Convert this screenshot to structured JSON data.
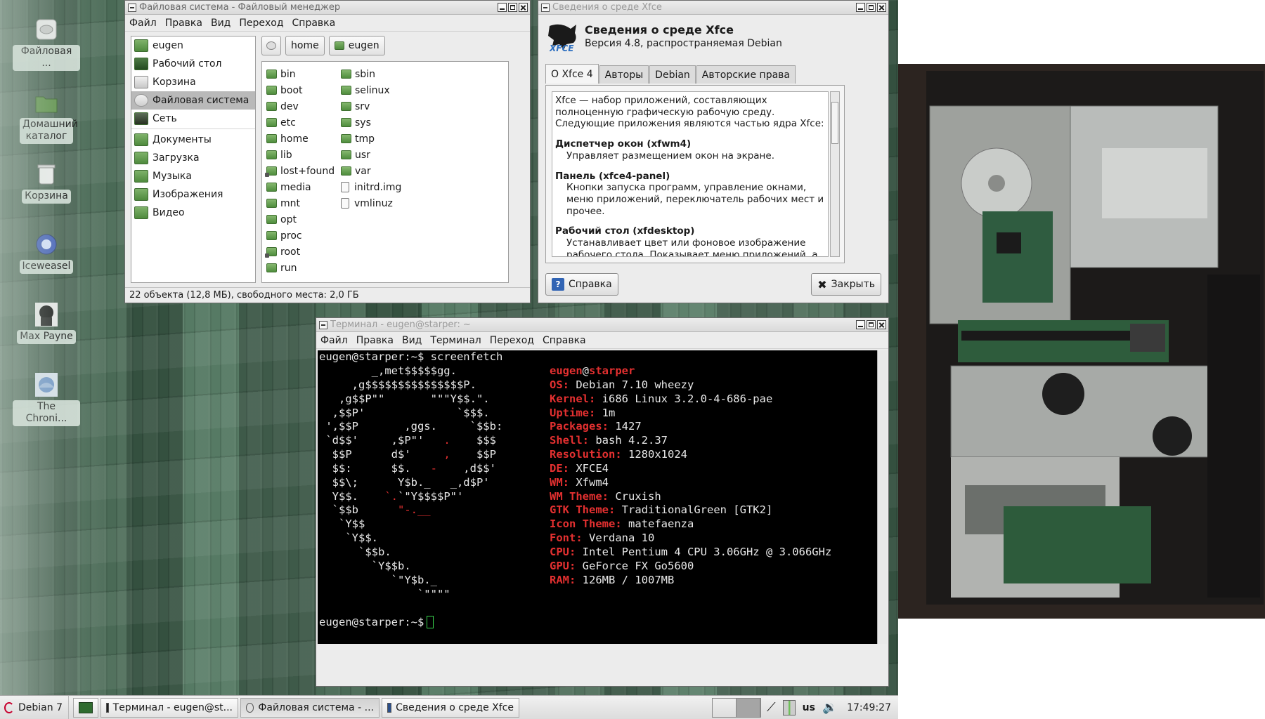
{
  "desktop": {
    "icons": [
      {
        "label": "Файловая ...",
        "icon": "filesystem-icon"
      },
      {
        "label": "Домашний каталог",
        "icon": "home-folder-icon"
      },
      {
        "label": "Корзина",
        "icon": "trash-icon"
      },
      {
        "label": "Iceweasel",
        "icon": "iceweasel-icon"
      },
      {
        "label": "Max Payne",
        "icon": "max-payne-icon"
      },
      {
        "label": "The Chroni...",
        "icon": "chronicles-icon"
      }
    ]
  },
  "file_manager": {
    "title": "Файловая система - Файловый менеджер",
    "menu": [
      "Файл",
      "Правка",
      "Вид",
      "Переход",
      "Справка"
    ],
    "sidebar": [
      {
        "label": "eugen",
        "icon": "home-icon"
      },
      {
        "label": "Рабочий стол",
        "icon": "desktop-icon"
      },
      {
        "label": "Корзина",
        "icon": "trash-icon"
      },
      {
        "label": "Файловая система",
        "icon": "filesystem-icon",
        "selected": true
      },
      {
        "label": "Сеть",
        "icon": "network-icon"
      },
      {
        "label": "Документы",
        "icon": "documents-icon"
      },
      {
        "label": "Загрузка",
        "icon": "downloads-icon"
      },
      {
        "label": "Музыка",
        "icon": "music-icon"
      },
      {
        "label": "Изображения",
        "icon": "pictures-icon"
      },
      {
        "label": "Видео",
        "icon": "video-icon"
      }
    ],
    "path": [
      "home",
      "eugen"
    ],
    "files_col1": [
      "bin",
      "boot",
      "dev",
      "etc",
      "home",
      "lib",
      "lost+found",
      "media",
      "mnt",
      "opt",
      "proc",
      "root",
      "run"
    ],
    "files_col2": [
      "sbin",
      "selinux",
      "srv",
      "sys",
      "tmp",
      "usr",
      "var",
      "initrd.img",
      "vmlinuz"
    ],
    "status": "22 объекта (12,8 МБ), свободного места: 2,0 ГБ"
  },
  "about": {
    "title": "Сведения о среде Xfce",
    "heading": "Сведения о среде Xfce",
    "version": "Версия 4.8, распространяемая Debian",
    "tabs": [
      "О Xfce 4",
      "Авторы",
      "Debian",
      "Авторские права"
    ],
    "intro": "Xfce — набор приложений, составляющих полноценную графическую рабочую среду. Следующие приложения являются частью ядра Xfce:",
    "sections": [
      {
        "h": "Диспетчер окон (xfwm4)",
        "d": "Управляет размещением окон на экране."
      },
      {
        "h": "Панель (xfce4-panel)",
        "d": "Кнопки запуска программ, управление окнами, меню приложений, переключатель рабочих мест и прочее."
      },
      {
        "h": "Рабочий стол (xfdesktop)",
        "d": "Устанавливает цвет или фоновое изображение рабочего стола. Показывает меню приложений, а также значки"
      }
    ],
    "help_label": "Справка",
    "close_label": "Закрыть"
  },
  "terminal": {
    "title": "Терминал - eugen@starper: ~",
    "menu": [
      "Файл",
      "Правка",
      "Вид",
      "Терминал",
      "Переход",
      "Справка"
    ],
    "prompt1": "eugen@starper:~$ screenfetch",
    "ascii": [
      "        _,met$$$$$gg.",
      "     ,g$$$$$$$$$$$$$$$P.",
      "   ,g$$P\"\"       \"\"\"Y$$.\".",
      "  ,$$P'              `$$$.",
      " ',$$P       ,ggs.     `$$b:",
      " `d$$'     ,$P\"'   .    $$$",
      "  $$P      d$'     ,    $$P",
      "  $$:      $$.   -    ,d$$'",
      "  $$\\;      Y$b._   _,d$P'",
      "  Y$$.    `.`\"Y$$$$P\"'",
      "  `$$b      \"-.__",
      "   `Y$$",
      "    `Y$$.",
      "      `$$b.",
      "        `Y$$b.",
      "           `\"Y$b._",
      "               `\"\"\"\""
    ],
    "user": "eugen",
    "host": "starper",
    "info": [
      {
        "k": "OS:",
        "v": "Debian 7.10 wheezy"
      },
      {
        "k": "Kernel:",
        "v": "i686 Linux 3.2.0-4-686-pae"
      },
      {
        "k": "Uptime:",
        "v": "1m"
      },
      {
        "k": "Packages:",
        "v": "1427"
      },
      {
        "k": "Shell:",
        "v": "bash 4.2.37"
      },
      {
        "k": "Resolution:",
        "v": "1280x1024"
      },
      {
        "k": "DE:",
        "v": "XFCE4"
      },
      {
        "k": "WM:",
        "v": "Xfwm4"
      },
      {
        "k": "WM Theme:",
        "v": "Cruxish"
      },
      {
        "k": "GTK Theme:",
        "v": "TraditionalGreen [GTK2]"
      },
      {
        "k": "Icon Theme:",
        "v": "matefaenza"
      },
      {
        "k": "Font:",
        "v": "Verdana 10"
      },
      {
        "k": "CPU:",
        "v": "Intel Pentium 4 CPU 3.06GHz @ 3.066GHz"
      },
      {
        "k": "GPU:",
        "v": "GeForce FX Go5600"
      },
      {
        "k": "RAM:",
        "v": "126MB / 1007MB"
      }
    ],
    "prompt2": "eugen@starper:~$"
  },
  "taskbar": {
    "start_label": "Debian 7",
    "tasks": [
      {
        "label": "Терминал - eugen@st...",
        "icon": "terminal-icon"
      },
      {
        "label": "Файловая система - ...",
        "icon": "file-manager-icon"
      },
      {
        "label": "Сведения о среде Xfce",
        "icon": "xfce-icon"
      }
    ],
    "keyboard_layout": "us",
    "clock": "17:49:27"
  }
}
